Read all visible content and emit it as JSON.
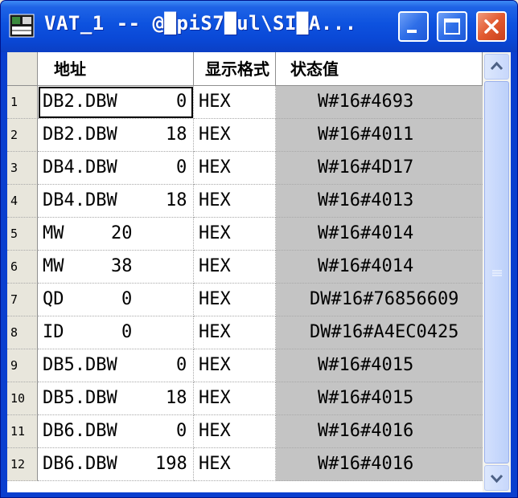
{
  "window": {
    "title": "VAT_1 -- @█piS7█ul\\SI█A...",
    "icons": {
      "app": "vat-table-icon",
      "minimize": "minimize-icon",
      "maximize": "maximize-icon",
      "close": "close-icon"
    }
  },
  "table": {
    "headers": {
      "address": "地址",
      "format": "显示格式",
      "status": "状态值"
    },
    "rows": [
      {
        "num": "1",
        "op": "DB2.DBW",
        "addr": "0",
        "fmt": "HEX",
        "val": "W#16#4693"
      },
      {
        "num": "2",
        "op": "DB2.DBW",
        "addr": "18",
        "fmt": "HEX",
        "val": "W#16#4011"
      },
      {
        "num": "3",
        "op": "DB4.DBW",
        "addr": "0",
        "fmt": "HEX",
        "val": "W#16#4D17"
      },
      {
        "num": "4",
        "op": "DB4.DBW",
        "addr": "18",
        "fmt": "HEX",
        "val": "W#16#4013"
      },
      {
        "num": "5",
        "op": "MW",
        "addr": "20",
        "fmt": "HEX",
        "val": "W#16#4014"
      },
      {
        "num": "6",
        "op": "MW",
        "addr": "38",
        "fmt": "HEX",
        "val": "W#16#4014"
      },
      {
        "num": "7",
        "op": "QD",
        "addr": "0",
        "fmt": "HEX",
        "val": "DW#16#76856609"
      },
      {
        "num": "8",
        "op": "ID",
        "addr": "0",
        "fmt": "HEX",
        "val": "DW#16#A4EC0425"
      },
      {
        "num": "9",
        "op": "DB5.DBW",
        "addr": "0",
        "fmt": "HEX",
        "val": "W#16#4015"
      },
      {
        "num": "10",
        "op": "DB5.DBW",
        "addr": "18",
        "fmt": "HEX",
        "val": "W#16#4015"
      },
      {
        "num": "11",
        "op": "DB6.DBW",
        "addr": "0",
        "fmt": "HEX",
        "val": "W#16#4016"
      },
      {
        "num": "12",
        "op": "DB6.DBW",
        "addr": "198",
        "fmt": "HEX",
        "val": "W#16#4016"
      }
    ]
  },
  "scrollbar": {
    "icons": {
      "up": "scroll-up-arrow-icon",
      "down": "scroll-down-arrow-icon",
      "grip": "grip-icon"
    }
  }
}
